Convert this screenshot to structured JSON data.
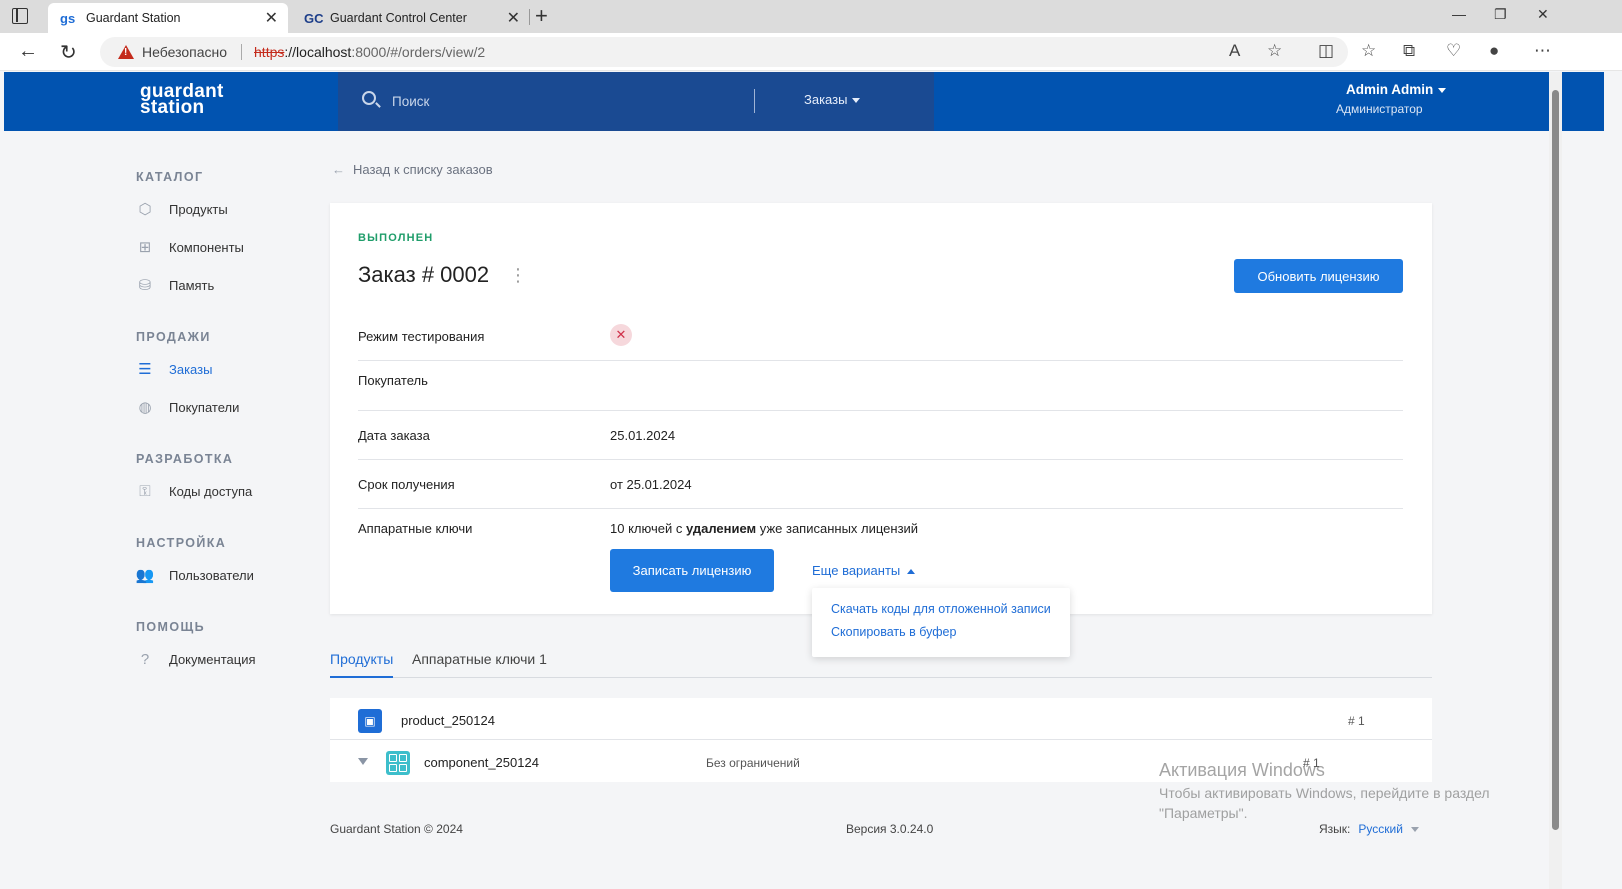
{
  "browser": {
    "tabs": [
      {
        "favicon": "gs",
        "title": "Guardant Station",
        "active": true
      },
      {
        "favicon": "GC",
        "title": "Guardant Control Center",
        "active": false
      }
    ],
    "security_label": "Небезопасно",
    "url": {
      "scheme": "https",
      "host": "://localhost",
      "path": ":8000/#/orders/view/2"
    }
  },
  "header": {
    "logo_line1": "guardant",
    "logo_line2": "station",
    "search_placeholder": "Поиск",
    "orders_menu": "Заказы",
    "user_name": "Admin Admin",
    "user_role": "Администратор"
  },
  "sidebar": {
    "sections": [
      {
        "title": "КАТАЛОГ",
        "items": [
          {
            "label": "Продукты",
            "icon": "cube-icon",
            "active": false
          },
          {
            "label": "Компоненты",
            "icon": "grid-icon",
            "active": false
          },
          {
            "label": "Память",
            "icon": "database-icon",
            "active": false
          }
        ]
      },
      {
        "title": "ПРОДАЖИ",
        "items": [
          {
            "label": "Заказы",
            "icon": "clipboard-icon",
            "active": true
          },
          {
            "label": "Покупатели",
            "icon": "globe-icon",
            "active": false
          }
        ]
      },
      {
        "title": "РАЗРАБОТКА",
        "items": [
          {
            "label": "Коды доступа",
            "icon": "key-icon",
            "active": false
          }
        ]
      },
      {
        "title": "НАСТРОЙКА",
        "items": [
          {
            "label": "Пользователи",
            "icon": "users-icon",
            "active": false
          }
        ]
      },
      {
        "title": "ПОМОЩЬ",
        "items": [
          {
            "label": "Документация",
            "icon": "help-icon",
            "active": false
          }
        ]
      }
    ]
  },
  "main": {
    "back_link": "Назад к списку заказов",
    "status": "ВЫПОЛНЕН",
    "title": "Заказ # 0002",
    "update_button": "Обновить лицензию",
    "fields": {
      "test_mode_label": "Режим тестирования",
      "buyer_label": "Покупатель",
      "order_date_label": "Дата заказа",
      "order_date_value": "25.01.2024",
      "receive_label": "Срок получения",
      "receive_value": "от 25.01.2024",
      "keys_label": "Аппаратные ключи",
      "keys_value_pre": "10 ключей с ",
      "keys_value_bold": "удалением",
      "keys_value_post": " уже записанных лицензий"
    },
    "write_button": "Записать лицензию",
    "more_options": "Еще варианты",
    "dropdown": [
      "Скачать коды для отложенной записи",
      "Скопировать в буфер"
    ],
    "tabs": [
      "Продукты",
      "Аппаратные ключи 1"
    ],
    "products": [
      {
        "name": "product_250124",
        "num": "# 1"
      },
      {
        "name": "component_250124",
        "limit": "Без ограничений",
        "num": "# 1"
      }
    ]
  },
  "footer": {
    "copyright": "Guardant Station © 2024",
    "version": "Версия 3.0.24.0",
    "lang_label": "Язык:",
    "lang_value": "Русский"
  },
  "watermark": {
    "title": "Активация Windows",
    "text": "Чтобы активировать Windows, перейдите в раздел \"Параметры\"."
  }
}
